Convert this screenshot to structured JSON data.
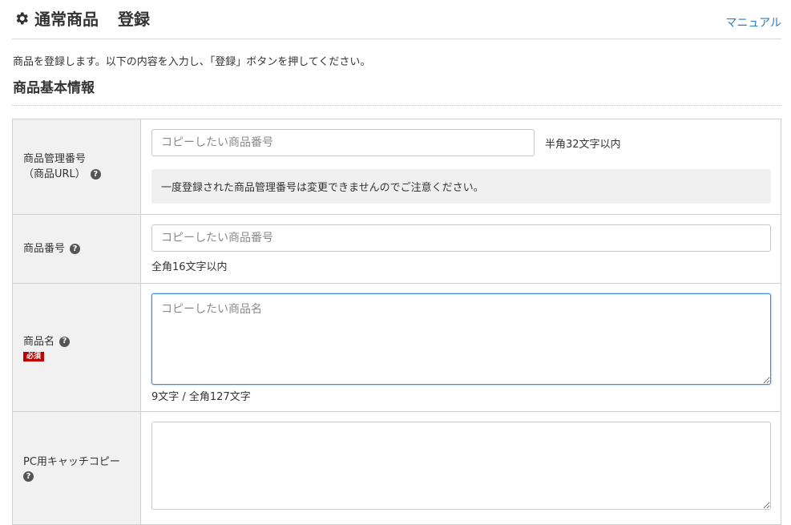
{
  "header": {
    "title_main": "通常商品",
    "title_action": "登録",
    "manual_link": "マニュアル"
  },
  "description": "商品を登録します。以下の内容を入力し、「登録」ボタンを押してください。",
  "section_title": "商品基本情報",
  "icons": {
    "title": "gear-icon",
    "help": "question-circle-icon"
  },
  "colors": {
    "link": "#2a7bbf",
    "required_badge": "#bf0000",
    "label_bg": "#f1f1f1",
    "focus_border": "#3b8dd6"
  },
  "fields": {
    "manage_number": {
      "label_line1": "商品管理番号",
      "label_line2": "（商品URL）",
      "placeholder": "コピーしたい商品番号",
      "hint": "半角32文字以内",
      "notice": "一度登録された商品管理番号は変更できませんのでご注意ください。"
    },
    "product_number": {
      "label": "商品番号",
      "placeholder": "コピーしたい商品番号",
      "hint": "全角16文字以内"
    },
    "product_name": {
      "label": "商品名",
      "required": "必須",
      "placeholder": "コピーしたい商品名",
      "counter": "9文字 / 全角127文字"
    },
    "pc_catch_copy": {
      "label": "PC用キャッチコピー",
      "value": ""
    }
  }
}
